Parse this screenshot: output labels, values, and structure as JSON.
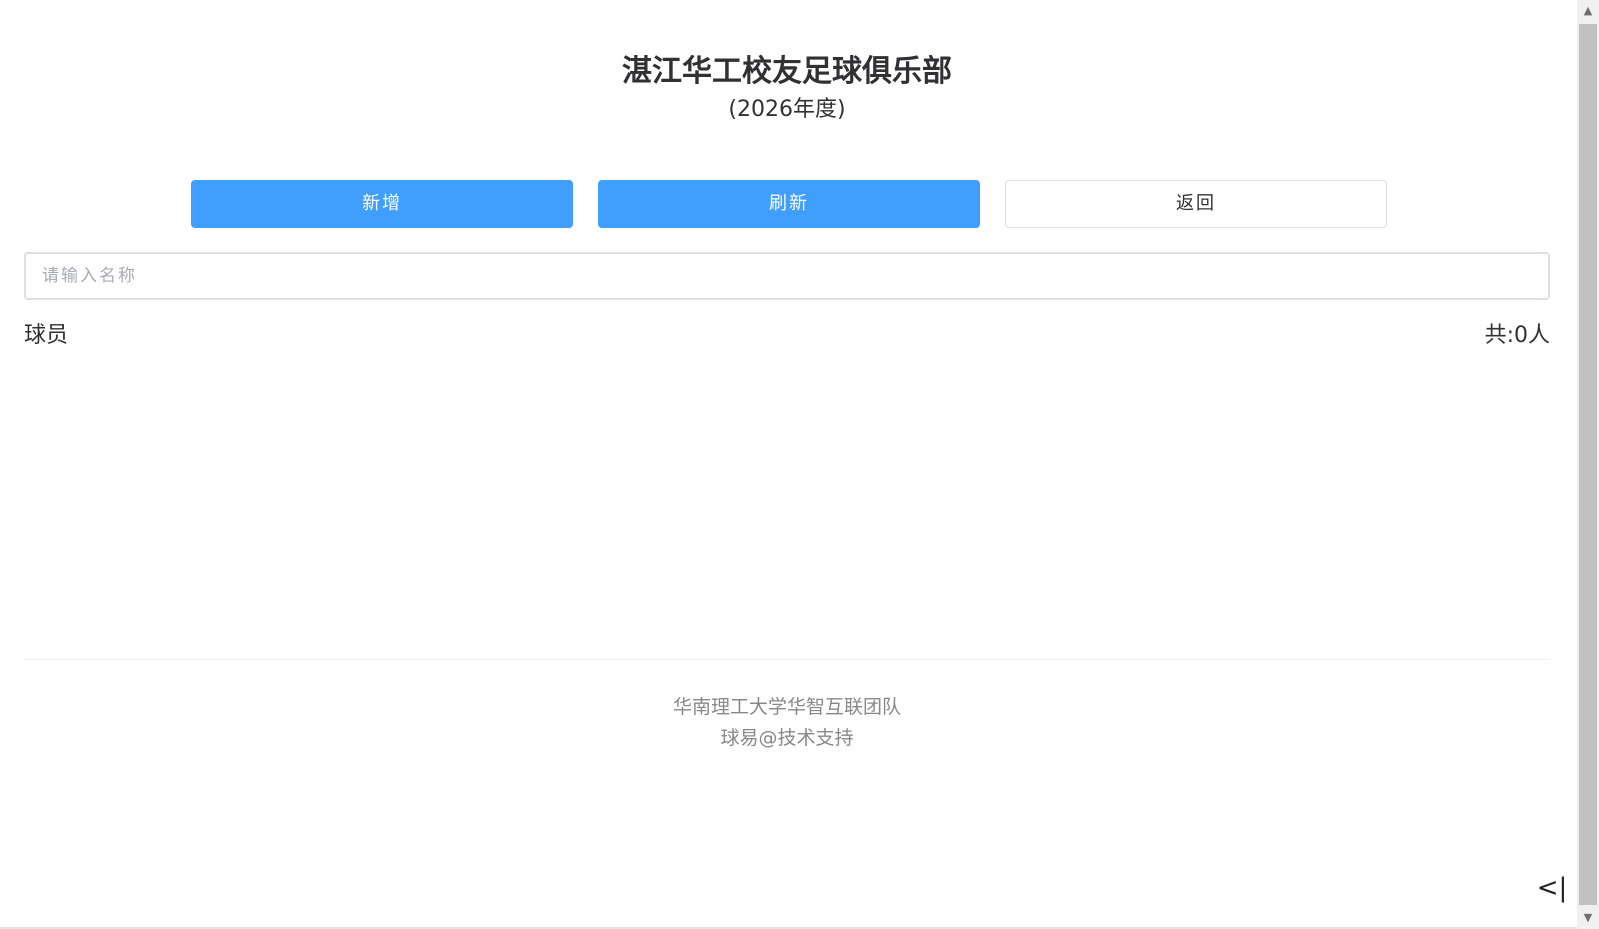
{
  "header": {
    "title": "湛江华工校友足球俱乐部",
    "subtitle": "(2026年度)"
  },
  "toolbar": {
    "add_label": "新增",
    "refresh_label": "刷新",
    "back_label": "返回"
  },
  "search": {
    "placeholder": "请输入名称",
    "value": ""
  },
  "list": {
    "label": "球员",
    "count_text": "共:0人",
    "items": []
  },
  "footer": {
    "line1": "华南理工大学华智互联团队",
    "line2": "球易@技术支持"
  },
  "collapse": {
    "glyph": "<|"
  },
  "colors": {
    "primary": "#409eff",
    "border": "#dcdfe6",
    "text": "#303133",
    "footer_text": "#888888"
  },
  "icons": {
    "scroll_up": "triangle-up-icon",
    "scroll_down": "triangle-down-icon",
    "collapse": "collapse-panel-icon"
  }
}
